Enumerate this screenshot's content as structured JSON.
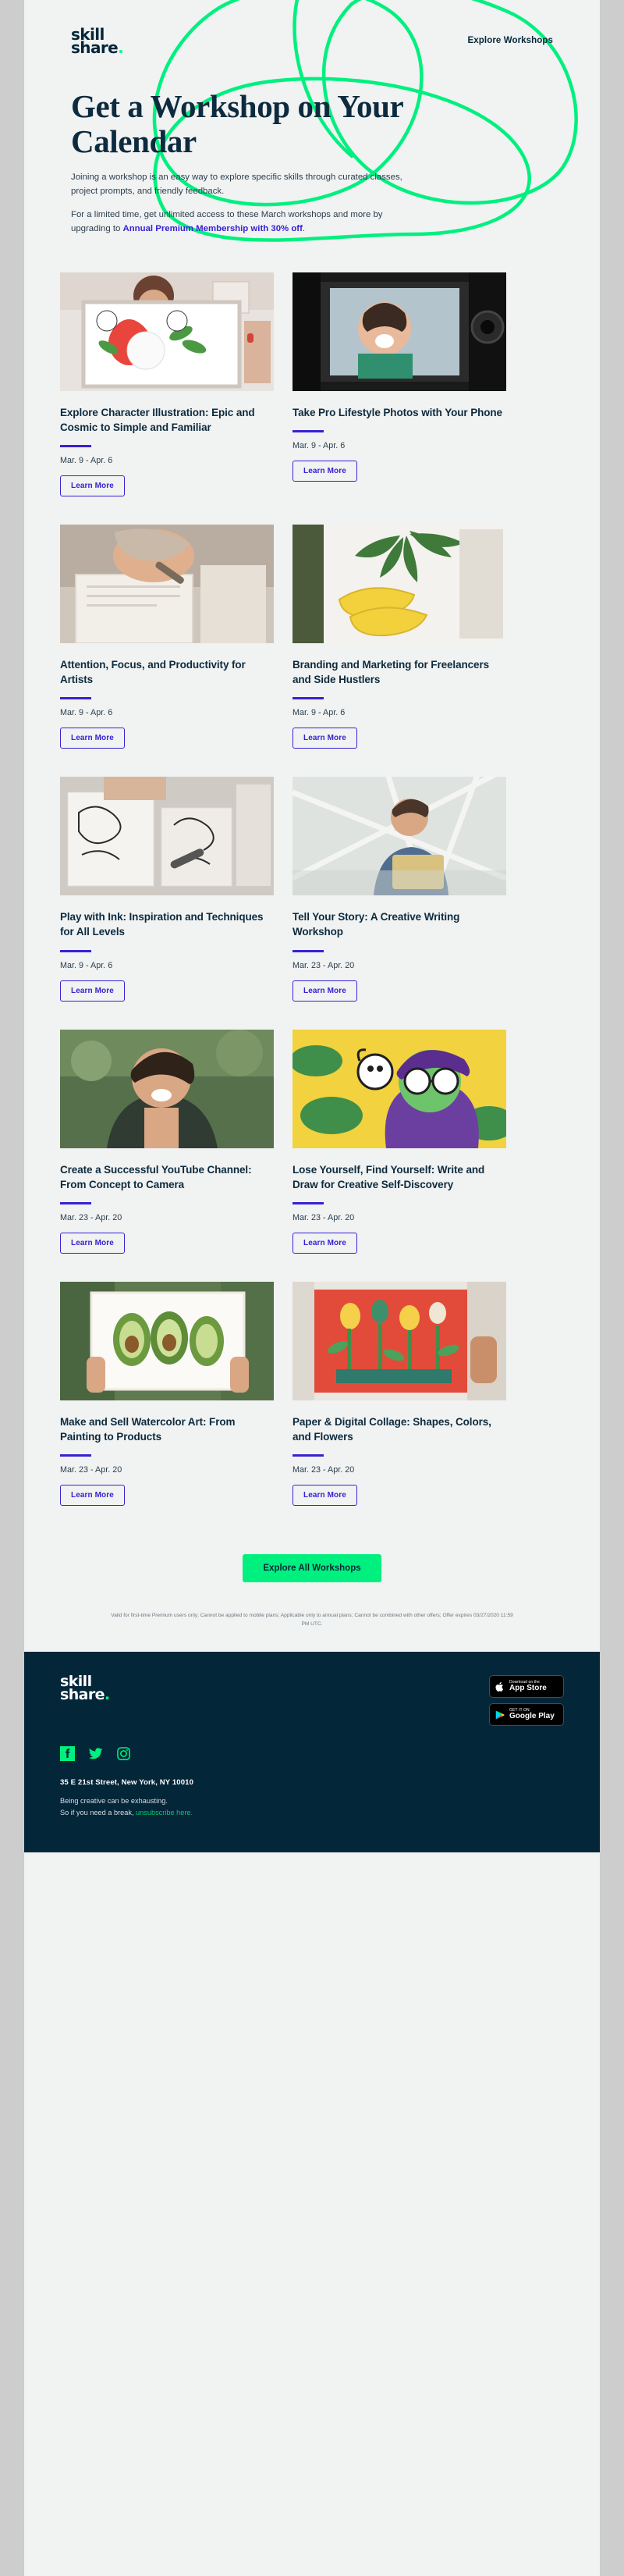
{
  "brand": {
    "logo_line1": "skill",
    "logo_line2": "share",
    "logo_dot": ".",
    "accent_green": "#00f07f",
    "accent_purple": "#3722d3",
    "dark_navy": "#032639",
    "page_bg": "#f1f2f2"
  },
  "header": {
    "explore_link": "Explore Workshops"
  },
  "hero": {
    "title": "Get a Workshop on Your Calendar",
    "paragraph1": "Joining a workshop is an easy way to explore specific skills through curated classes, project prompts, and friendly feedback.",
    "paragraph2_prefix": "For a limited time, get unlimited access to these March workshops and more by upgrading to ",
    "paragraph2_link": "Annual Premium Membership with 30% off",
    "paragraph2_suffix": "."
  },
  "cards": [
    {
      "title": "Explore Character Illustration: Epic and Cosmic to Simple and Familiar",
      "date": "Mar. 9 - Apr. 6",
      "button": "Learn More",
      "image_alt": "woman-holding-illustration"
    },
    {
      "title": "Take Pro Lifestyle Photos with Your Phone",
      "date": "Mar. 9 - Apr. 6",
      "button": "Learn More",
      "image_alt": "laughing-woman-camera-screen"
    },
    {
      "title": "Attention, Focus, and Productivity for Artists",
      "date": "Mar. 9 - Apr. 6",
      "button": "Learn More",
      "image_alt": "hands-writing-sketchbook-desk"
    },
    {
      "title": "Branding and Marketing for Freelancers and Side Hustlers",
      "date": "Mar. 9 - Apr. 6",
      "button": "Learn More",
      "image_alt": "bananas-palm-leaf-painting"
    },
    {
      "title": "Play with Ink: Inspiration and Techniques for All Levels",
      "date": "Mar. 9 - Apr. 6",
      "button": "Learn More",
      "image_alt": "ink-drawings-on-desk"
    },
    {
      "title": "Tell Your Story: A Creative Writing Workshop",
      "date": "Mar. 23 - Apr. 20",
      "button": "Learn More",
      "image_alt": "man-writing-by-window"
    },
    {
      "title": "Create a Successful YouTube Channel: From Concept to Camera",
      "date": "Mar. 23 - Apr. 20",
      "button": "Learn More",
      "image_alt": "smiling-woman-portrait"
    },
    {
      "title": "Lose Yourself, Find Yourself: Write and Draw for Creative Self-Discovery",
      "date": "Mar. 23 - Apr. 20",
      "button": "Learn More",
      "image_alt": "illustrated-woman-with-dog"
    },
    {
      "title": "Make and Sell Watercolor Art: From Painting to Products",
      "date": "Mar. 23 - Apr. 20",
      "button": "Learn More",
      "image_alt": "avocado-watercolor-painting"
    },
    {
      "title": "Paper & Digital Collage: Shapes, Colors, and Flowers",
      "date": "Mar. 23 - Apr. 20",
      "button": "Learn More",
      "image_alt": "paper-collage-flowers"
    }
  ],
  "cta": {
    "label": "Explore All Workshops"
  },
  "disclaimer": {
    "text": "Valid for first-time Premium users only; Cannot be applied to mobile plans; Applicable only to annual plans; Cannot be combined with other offers; Offer expires 03/27/2020 11:59 PM UTC."
  },
  "footer": {
    "app_store": {
      "small": "Download on the",
      "big": "App Store",
      "icon": "apple-icon"
    },
    "google_play": {
      "small": "GET IT ON",
      "big": "Google Play",
      "icon": "google-play-icon"
    },
    "socials": [
      {
        "name": "facebook-icon"
      },
      {
        "name": "twitter-icon"
      },
      {
        "name": "instagram-icon"
      }
    ],
    "address": "35 E 21st Street, New York, NY 10010",
    "note_line1": "Being creative can be exhausting.",
    "note_line2_prefix": "So if you need a break, ",
    "note_link": "unsubscribe here.",
    "logo_line1": "skill",
    "logo_line2": "share",
    "logo_dot": "."
  }
}
